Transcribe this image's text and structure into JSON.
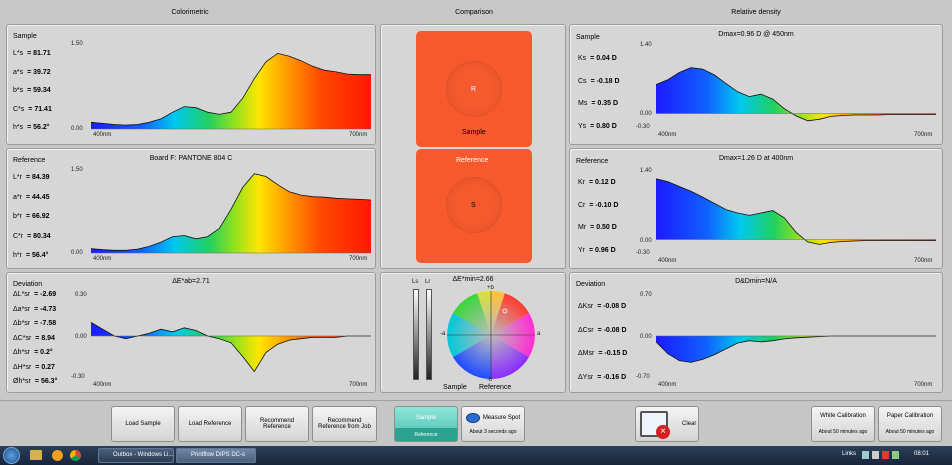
{
  "headers": {
    "colorimetric": "Colorimetric",
    "comparison": "Comparison",
    "relative_density": "Relative density"
  },
  "sample_panel": {
    "title": "Sample",
    "rows": [
      {
        "label": "L*s",
        "value": "= 81.71"
      },
      {
        "label": "a*s",
        "value": "= 39.72"
      },
      {
        "label": "b*s",
        "value": "= 59.34"
      },
      {
        "label": "C*s",
        "value": "= 71.41"
      },
      {
        "label": "h*s",
        "value": "= 56.2°"
      }
    ],
    "ymax": "1.50",
    "ymin": "0.00",
    "xmin": "400nm",
    "xmax": "700nm",
    "curve": [
      0.12,
      0.1,
      0.08,
      0.07,
      0.08,
      0.12,
      0.18,
      0.3,
      0.4,
      0.38,
      0.3,
      0.26,
      0.3,
      0.55,
      0.9,
      1.2,
      1.35,
      1.3,
      1.22,
      1.12,
      1.05,
      1.02,
      0.98,
      0.97,
      0.97
    ]
  },
  "reference_panel": {
    "title": "Reference",
    "caption": "Board F: PANTONE 804 C",
    "rows": [
      {
        "label": "L*r",
        "value": "= 84.39"
      },
      {
        "label": "a*r",
        "value": "= 44.45"
      },
      {
        "label": "b*r",
        "value": "= 66.92"
      },
      {
        "label": "C*r",
        "value": "= 80.34"
      },
      {
        "label": "h*r",
        "value": "= 56.4°"
      }
    ],
    "ymax": "1.50",
    "ymin": "0.00",
    "xmin": "400nm",
    "xmax": "700nm",
    "curve": [
      0.08,
      0.06,
      0.05,
      0.05,
      0.07,
      0.12,
      0.2,
      0.3,
      0.32,
      0.26,
      0.3,
      0.45,
      0.8,
      1.2,
      1.45,
      1.4,
      1.25,
      1.12,
      1.06,
      1.03,
      1.02,
      1.0,
      0.99,
      0.98,
      0.97
    ]
  },
  "deviation_panel": {
    "title": "Deviation",
    "caption": "ΔE*ab=2.71",
    "rows": [
      {
        "label": "ΔL*sr",
        "value": "= -2.69"
      },
      {
        "label": "Δa*sr",
        "value": "= -4.73"
      },
      {
        "label": "Δb*sr",
        "value": "= -7.58"
      },
      {
        "label": "ΔC*sr",
        "value": "= 8.94"
      },
      {
        "label": "Δh*sr",
        "value": "= 0.2°"
      },
      {
        "label": "ΔH*sr",
        "value": "= 0.27"
      },
      {
        "label": "Øh*sr",
        "value": "= 56.3°"
      }
    ],
    "ymax": "0.30",
    "ymid": "0.00",
    "ymin": "-0.30",
    "xmin": "400nm",
    "xmax": "700nm",
    "curve": [
      0.1,
      0.05,
      0.0,
      -0.02,
      0.0,
      0.02,
      0.05,
      0.03,
      0.06,
      0.04,
      0.0,
      -0.02,
      -0.05,
      -0.15,
      -0.26,
      -0.12,
      -0.06,
      -0.03,
      -0.02,
      -0.01,
      -0.01,
      -0.01,
      0.0,
      0.0,
      0.0
    ]
  },
  "comparison": {
    "sample_circle": "R",
    "sample_label": "Sample",
    "reference_label": "Reference",
    "reference_circle": "S",
    "swatch_color": "#f5592d"
  },
  "delta_panel": {
    "caption": "ΔE*min=2.66",
    "meter_labels": [
      "Ls",
      "Lr"
    ],
    "plus_b": "+b",
    "minus_b": "-b",
    "plus_a": "a",
    "minus_a": "-a",
    "legend_sample": "Sample",
    "legend_reference": "Reference"
  },
  "rd_sample": {
    "title": "Sample",
    "caption": "Dmax=0.96 D @ 450nm",
    "rows": [
      {
        "label": "Ks",
        "value": "= 0.04 D"
      },
      {
        "label": "Cs",
        "value": "= -0.18 D"
      },
      {
        "label": "Ms",
        "value": "= 0.35 D"
      },
      {
        "label": "Ys",
        "value": "= 0.80 D"
      }
    ],
    "ymax": "1.40",
    "ymid": "0.00",
    "ymin": "-0.30",
    "xmin": "400nm",
    "xmax": "700nm",
    "curve": [
      0.6,
      0.7,
      0.85,
      0.95,
      0.92,
      0.8,
      0.62,
      0.45,
      0.35,
      0.4,
      0.3,
      0.1,
      -0.05,
      -0.15,
      -0.12,
      -0.06,
      -0.04,
      -0.03,
      -0.03,
      -0.03,
      -0.02,
      -0.02,
      -0.02,
      -0.02,
      -0.02
    ]
  },
  "rd_reference": {
    "title": "Reference",
    "caption": "Dmax=1.26 D at 400nm",
    "rows": [
      {
        "label": "Kr",
        "value": "= 0.12 D"
      },
      {
        "label": "Cr",
        "value": "= -0.10 D"
      },
      {
        "label": "Mr",
        "value": "= 0.50 D"
      },
      {
        "label": "Yr",
        "value": "= 0.96 D"
      }
    ],
    "ymax": "1.40",
    "ymid": "0.00",
    "ymin": "-0.30",
    "xmin": "400nm",
    "xmax": "700nm",
    "curve": [
      1.26,
      1.2,
      1.1,
      1.0,
      0.88,
      0.75,
      0.62,
      0.55,
      0.5,
      0.55,
      0.6,
      0.45,
      0.15,
      -0.05,
      -0.1,
      -0.06,
      -0.04,
      -0.03,
      -0.02,
      -0.02,
      -0.02,
      -0.02,
      -0.02,
      -0.02,
      -0.02
    ]
  },
  "rd_deviation": {
    "title": "Deviation",
    "caption": "D&Dmin=N/A",
    "rows": [
      {
        "label": "ΔKsr",
        "value": "= -0.08 D"
      },
      {
        "label": "ΔCsr",
        "value": "= -0.08 D"
      },
      {
        "label": "ΔMsr",
        "value": "= -0.15 D"
      },
      {
        "label": "ΔYsr",
        "value": "= -0.16 D"
      }
    ],
    "ymax": "0.70",
    "ymid": "0.00",
    "ymin": "-0.70",
    "xmin": "400nm",
    "xmax": "700nm",
    "curve": [
      -0.1,
      -0.3,
      -0.42,
      -0.45,
      -0.4,
      -0.32,
      -0.22,
      -0.12,
      -0.08,
      -0.1,
      -0.08,
      -0.05,
      -0.03,
      -0.02,
      -0.01,
      0.0,
      0.0,
      0.0,
      0.0,
      0.0,
      0.0,
      0.0,
      0.0,
      0.0,
      0.0
    ]
  },
  "buttons": {
    "load_sample": "Load Sample",
    "load_reference": "Load Reference",
    "recommend_reference": "Recommend Reference",
    "recommend_from_job": "Recommend Reference from Job",
    "sample_toggle": "Sample",
    "reference_toggle": "Reference",
    "measure_spot": "Measure Spot",
    "measure_time": "About 3 seconds ago",
    "clear": "Clear",
    "white_cal": "White Calibration",
    "white_cal_time": "About 50 minutes ago",
    "paper_cal": "Paper Calibration",
    "paper_cal_time": "About 50 minutes ago"
  },
  "taskbar": {
    "outbox": "Outbox - Windows Li...",
    "printflow": "Printflow DIPS DC-s",
    "links": "Links",
    "clock": "08:01"
  }
}
